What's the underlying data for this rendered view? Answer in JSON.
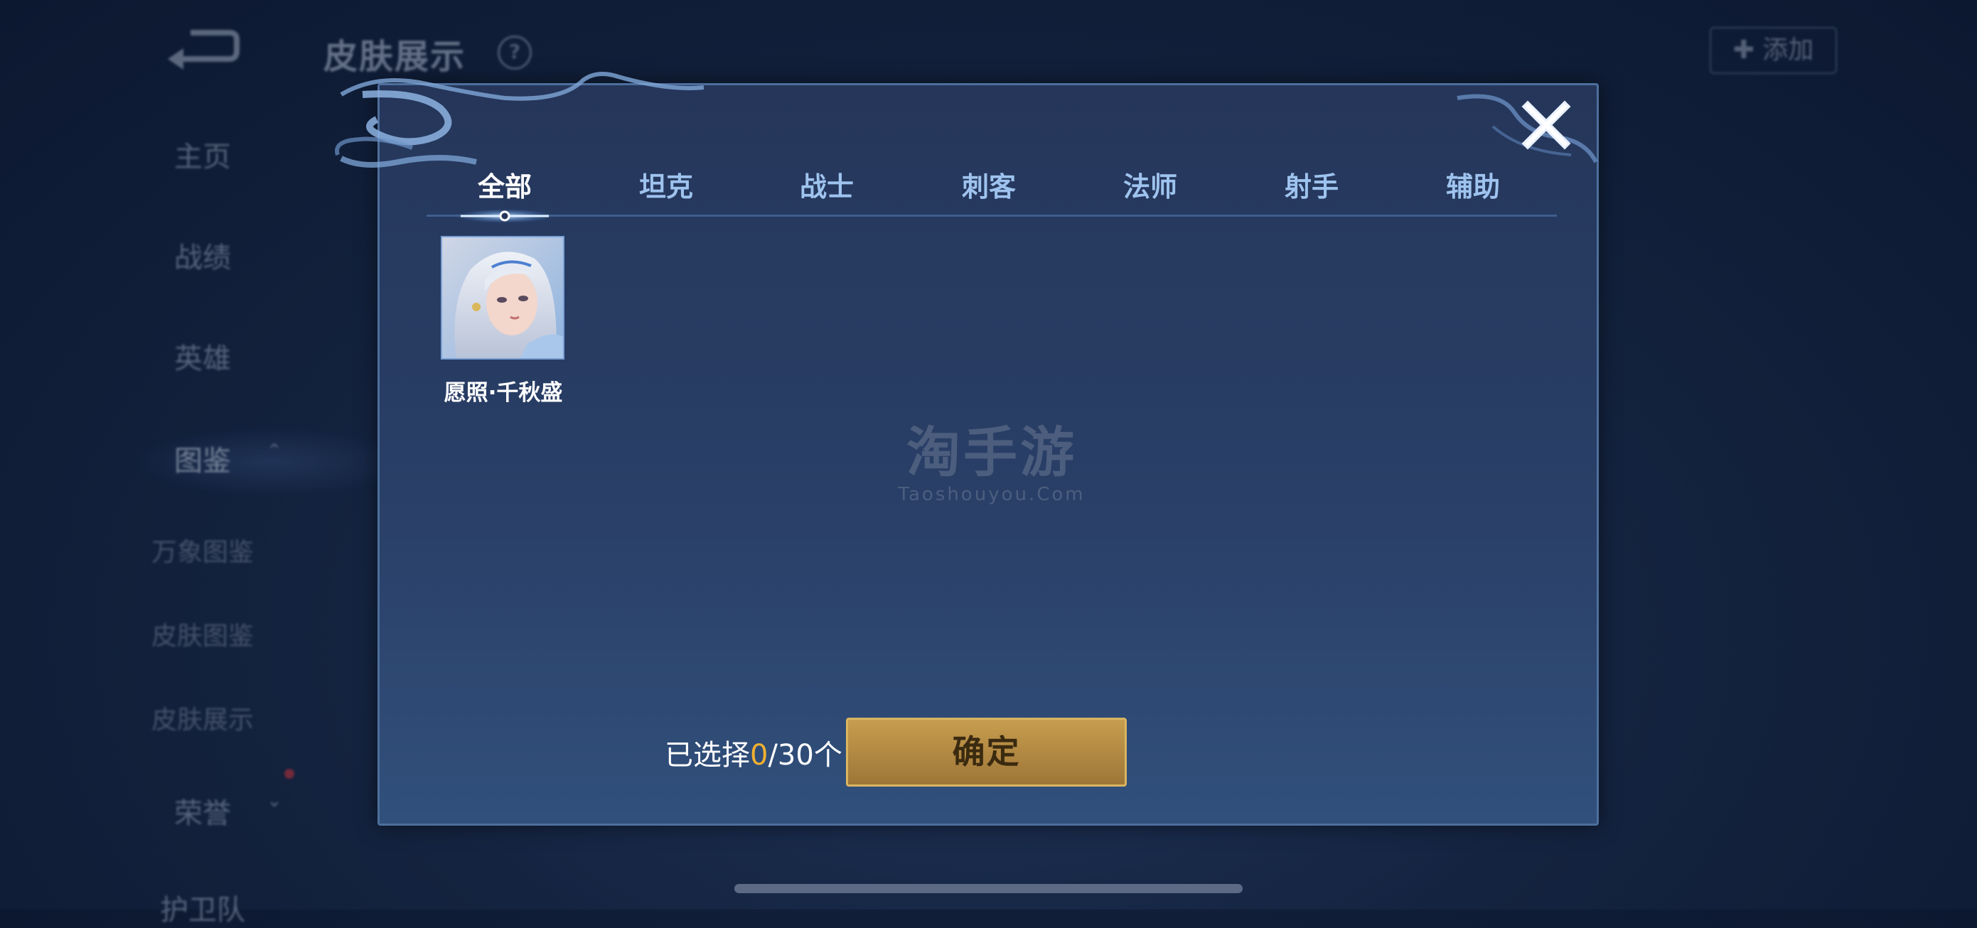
{
  "background": {
    "page_title": "皮肤展示",
    "help_icon": "?",
    "add_button": "✚ 添加",
    "sidebar": {
      "items": [
        {
          "label": "主页"
        },
        {
          "label": "战绩"
        },
        {
          "label": "英雄"
        },
        {
          "label": "图鉴"
        },
        {
          "label": "万象图鉴"
        },
        {
          "label": "皮肤图鉴"
        },
        {
          "label": "皮肤展示"
        },
        {
          "label": "荣誉"
        },
        {
          "label": "护卫队"
        }
      ]
    }
  },
  "modal": {
    "tabs": [
      {
        "label": "全部",
        "active": true
      },
      {
        "label": "坦克"
      },
      {
        "label": "战士"
      },
      {
        "label": "刺客"
      },
      {
        "label": "法师"
      },
      {
        "label": "射手"
      },
      {
        "label": "辅助"
      }
    ],
    "skins": [
      {
        "name": "愿照·千秋盛",
        "portrait": "skin-portrait"
      }
    ],
    "watermark": {
      "cn": "淘手游",
      "en": "Taoshouyou.Com"
    },
    "selection": {
      "prefix": "已选择",
      "count": "0",
      "suffix": "/30个"
    },
    "confirm_label": "确定"
  },
  "colors": {
    "accent_gold": "#f0b030",
    "tab_text": "#9ec3ee",
    "confirm_button": "#b58b44"
  }
}
